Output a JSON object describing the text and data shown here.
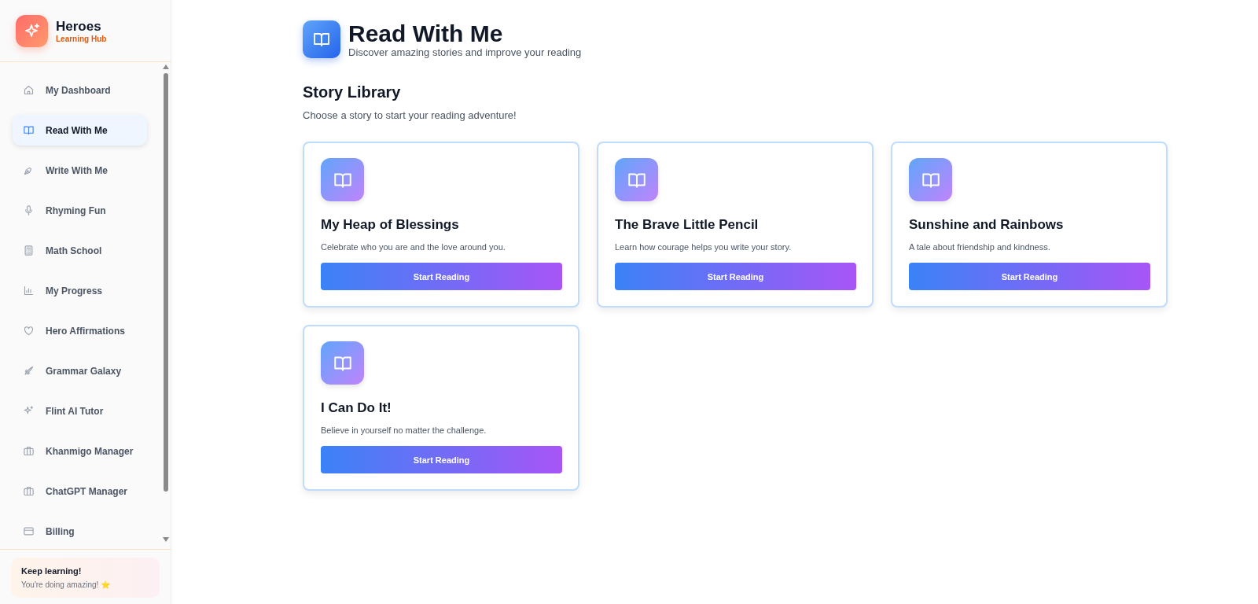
{
  "brand": {
    "name": "Heroes",
    "tagline": "Learning Hub"
  },
  "sidebar": {
    "items": [
      {
        "label": "My Dashboard",
        "selected": false
      },
      {
        "label": "Read With Me",
        "selected": true
      },
      {
        "label": "Write With Me",
        "selected": false
      },
      {
        "label": "Rhyming Fun",
        "selected": false
      },
      {
        "label": "Math School",
        "selected": false
      },
      {
        "label": "My Progress",
        "selected": false
      },
      {
        "label": "Hero Affirmations",
        "selected": false
      },
      {
        "label": "Grammar Galaxy",
        "selected": false
      },
      {
        "label": "Flint AI Tutor",
        "selected": false
      },
      {
        "label": "Khanmigo Manager",
        "selected": false
      },
      {
        "label": "ChatGPT Manager",
        "selected": false
      },
      {
        "label": "Billing",
        "selected": false
      }
    ]
  },
  "encouragement": {
    "title": "Keep learning!",
    "text": "You're doing amazing! ⭐"
  },
  "page": {
    "title": "Read With Me",
    "subtitle": "Discover amazing stories and improve your reading"
  },
  "library": {
    "title": "Story Library",
    "subtitle": "Choose a story to start your reading adventure!",
    "stories": [
      {
        "title": "My Heap of Blessings",
        "description": "Celebrate who you are and the love around you.",
        "button": "Start Reading"
      },
      {
        "title": "The Brave Little Pencil",
        "description": "Learn how courage helps you write your story.",
        "button": "Start Reading"
      },
      {
        "title": "Sunshine and Rainbows",
        "description": "A tale about friendship and kindness.",
        "button": "Start Reading"
      },
      {
        "title": "I Can Do It!",
        "description": "Believe in yourself no matter the challenge.",
        "button": "Start Reading"
      }
    ]
  }
}
